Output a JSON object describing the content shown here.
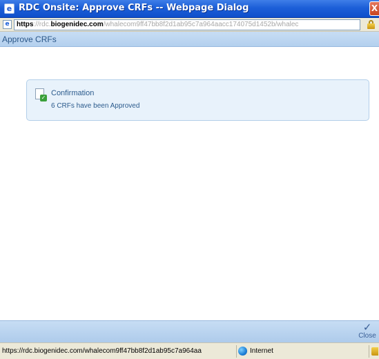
{
  "window": {
    "title": "RDC Onsite: Approve CRFs -- Webpage Dialog",
    "app_icon": "ie-icon",
    "close_glyph": "X"
  },
  "address_bar": {
    "scheme": "https",
    "separator": "://",
    "subdomain": "rdc.",
    "domain": "biogenidec.com",
    "path": "/whalecom9ff47bb8f2d1ab95c7a964aacc174075d1452b/whalec",
    "secure_icon": "lock-icon"
  },
  "page": {
    "heading": "Approve CRFs"
  },
  "confirmation": {
    "icon": "document-check-icon",
    "title": "Confirmation",
    "message": "6 CRFs have been Approved"
  },
  "footer": {
    "close_label": "Close",
    "close_icon": "checkmark-icon"
  },
  "status_bar": {
    "url": "https://rdc.biogenidec.com/whalecom9ff47bb8f2d1ab95c7a964aa",
    "zone": "Internet",
    "zone_icon": "globe-icon"
  }
}
